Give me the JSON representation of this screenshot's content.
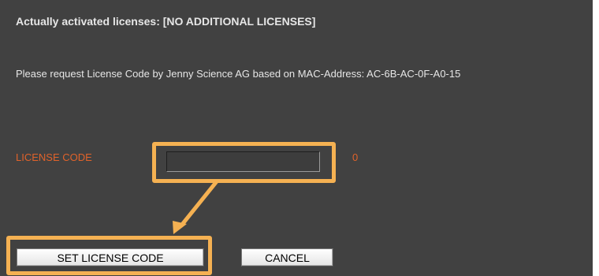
{
  "dialog": {
    "status_text": "Actually activated licenses: [NO ADDITIONAL LICENSES]",
    "mac_text": "Please request License Code by Jenny Science AG based on MAC-Address: AC-6B-AC-0F-A0-15",
    "license_label": "LICENSE CODE",
    "license_value": "",
    "char_count": "0",
    "set_button_label": "SET LICENSE CODE",
    "cancel_button_label": "CANCEL"
  },
  "colors": {
    "background": "#414141",
    "text": "#e6e6e6",
    "label_accent": "#e0622a",
    "annotation": "#f5b152"
  }
}
